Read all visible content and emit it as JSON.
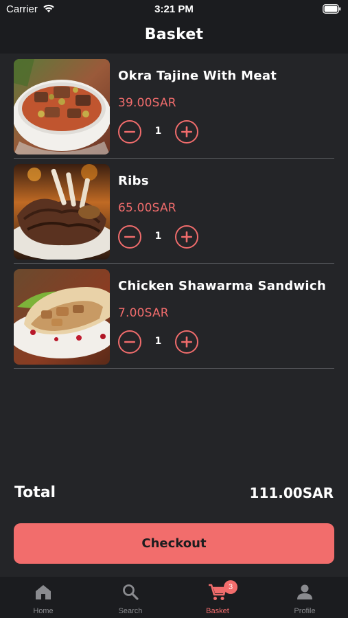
{
  "status_bar": {
    "carrier": "Carrier",
    "time": "3:21 PM"
  },
  "header": {
    "title": "Basket"
  },
  "basket": {
    "items": [
      {
        "name": "Okra Tajine With Meat",
        "price": "39.00SAR",
        "quantity": "1",
        "image": "okra-tajine-photo"
      },
      {
        "name": "Ribs",
        "price": "65.00SAR",
        "quantity": "1",
        "image": "grilled-ribs-photo"
      },
      {
        "name": "Chicken Shawarma Sandwich",
        "price": "7.00SAR",
        "quantity": "1",
        "image": "shawarma-sandwich-photo"
      }
    ]
  },
  "summary": {
    "total_label": "Total",
    "total_value": "111.00SAR"
  },
  "checkout": {
    "label": "Checkout"
  },
  "tabbar": {
    "tabs": [
      {
        "label": "Home",
        "icon": "home-icon"
      },
      {
        "label": "Search",
        "icon": "search-icon"
      },
      {
        "label": "Basket",
        "icon": "cart-icon",
        "badge": "3",
        "active": true
      },
      {
        "label": "Profile",
        "icon": "profile-icon"
      }
    ]
  },
  "colors": {
    "accent": "#f26d6c",
    "background": "#242528",
    "bar": "#1b1c1f"
  }
}
